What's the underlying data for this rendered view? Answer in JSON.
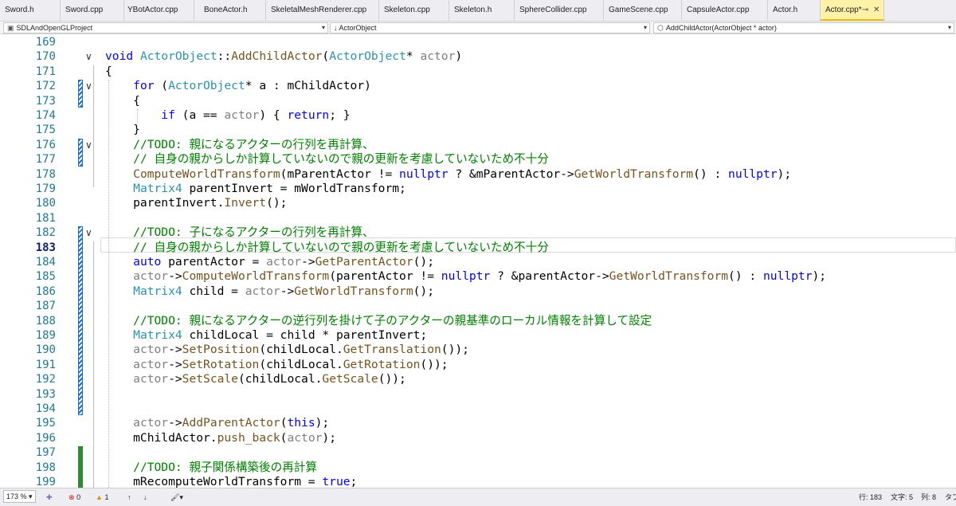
{
  "tabs": [
    {
      "label": "Sword.h",
      "active": false
    },
    {
      "label": "Sword.cpp",
      "active": false
    },
    {
      "label": "YBotActor.cpp",
      "active": false
    },
    {
      "label": "BoneActor.h",
      "active": false
    },
    {
      "label": "SkeletalMeshRenderer.cpp",
      "active": false
    },
    {
      "label": "Skeleton.cpp",
      "active": false
    },
    {
      "label": "Skeleton.h",
      "active": false
    },
    {
      "label": "SphereCollider.cpp",
      "active": false
    },
    {
      "label": "GameScene.cpp",
      "active": false
    },
    {
      "label": "CapsuleActor.cpp",
      "active": false
    },
    {
      "label": "Actor.h",
      "active": false
    },
    {
      "label": "Actor.cpp*",
      "active": true
    }
  ],
  "tab_controls": {
    "pin": "⊸",
    "close": "✕"
  },
  "nav": {
    "project": "SDLAndOpenGLProject",
    "scope": "↓ ActorObject",
    "member": "AddChildActor(ActorObject * actor)"
  },
  "current_line": 183,
  "code_lines": [
    {
      "num": 169,
      "fold": "",
      "tokens": []
    },
    {
      "num": 170,
      "fold": "∨",
      "tokens": [
        {
          "t": "void",
          "c": "kw"
        },
        {
          "t": " "
        },
        {
          "t": "ActorObject",
          "c": "ty"
        },
        {
          "t": "::"
        },
        {
          "t": "AddChildActor",
          "c": "fn"
        },
        {
          "t": "("
        },
        {
          "t": "ActorObject",
          "c": "ty"
        },
        {
          "t": "* "
        },
        {
          "t": "actor",
          "c": "pm"
        },
        {
          "t": ")"
        }
      ]
    },
    {
      "num": 171,
      "fold": "",
      "tokens": [
        {
          "t": "{"
        }
      ]
    },
    {
      "num": 172,
      "fold": "∨",
      "tokens": [
        {
          "t": "    "
        },
        {
          "t": "for",
          "c": "kw"
        },
        {
          "t": " ("
        },
        {
          "t": "ActorObject",
          "c": "ty"
        },
        {
          "t": "* a : mChildActor)"
        }
      ]
    },
    {
      "num": 173,
      "fold": "",
      "tokens": [
        {
          "t": "    {"
        }
      ]
    },
    {
      "num": 174,
      "fold": "",
      "tokens": [
        {
          "t": "        "
        },
        {
          "t": "if",
          "c": "kw"
        },
        {
          "t": " (a == "
        },
        {
          "t": "actor",
          "c": "pm"
        },
        {
          "t": ") { "
        },
        {
          "t": "return",
          "c": "kw"
        },
        {
          "t": "; }"
        }
      ]
    },
    {
      "num": 175,
      "fold": "",
      "tokens": [
        {
          "t": "    }"
        }
      ]
    },
    {
      "num": 176,
      "fold": "∨",
      "tokens": [
        {
          "t": "    "
        },
        {
          "t": "//TODO: 親になるアクターの行列を再計算、",
          "c": "cm"
        }
      ]
    },
    {
      "num": 177,
      "fold": "",
      "tokens": [
        {
          "t": "    "
        },
        {
          "t": "// 自身の親からしか計算していないので親の更新を考慮していないため不十分",
          "c": "cm"
        }
      ]
    },
    {
      "num": 178,
      "fold": "",
      "tokens": [
        {
          "t": "    "
        },
        {
          "t": "ComputeWorldTransform",
          "c": "fn"
        },
        {
          "t": "(mParentActor != "
        },
        {
          "t": "nullptr",
          "c": "kw"
        },
        {
          "t": " ? &mParentActor->"
        },
        {
          "t": "GetWorldTransform",
          "c": "fn"
        },
        {
          "t": "() : "
        },
        {
          "t": "nullptr",
          "c": "kw"
        },
        {
          "t": ");"
        }
      ]
    },
    {
      "num": 179,
      "fold": "",
      "tokens": [
        {
          "t": "    "
        },
        {
          "t": "Matrix4",
          "c": "ty"
        },
        {
          "t": " parentInvert = mWorldTransform;"
        }
      ]
    },
    {
      "num": 180,
      "fold": "",
      "tokens": [
        {
          "t": "    parentInvert."
        },
        {
          "t": "Invert",
          "c": "fn"
        },
        {
          "t": "();"
        }
      ]
    },
    {
      "num": 181,
      "fold": "",
      "tokens": []
    },
    {
      "num": 182,
      "fold": "∨",
      "tokens": [
        {
          "t": "    "
        },
        {
          "t": "//TODO: 子になるアクターの行列を再計算、",
          "c": "cm"
        }
      ]
    },
    {
      "num": 183,
      "fold": "",
      "tokens": [
        {
          "t": "    "
        },
        {
          "t": "// 自身の親からしか計算していないので親の更新を考慮していないため不十分",
          "c": "cm"
        }
      ]
    },
    {
      "num": 184,
      "fold": "",
      "tokens": [
        {
          "t": "    "
        },
        {
          "t": "auto",
          "c": "kw"
        },
        {
          "t": " parentActor = "
        },
        {
          "t": "actor",
          "c": "pm"
        },
        {
          "t": "->"
        },
        {
          "t": "GetParentActor",
          "c": "fn"
        },
        {
          "t": "();"
        }
      ]
    },
    {
      "num": 185,
      "fold": "",
      "tokens": [
        {
          "t": "    "
        },
        {
          "t": "actor",
          "c": "pm"
        },
        {
          "t": "->"
        },
        {
          "t": "ComputeWorldTransform",
          "c": "fn"
        },
        {
          "t": "(parentActor != "
        },
        {
          "t": "nullptr",
          "c": "kw"
        },
        {
          "t": " ? &parentActor->"
        },
        {
          "t": "GetWorldTransform",
          "c": "fn"
        },
        {
          "t": "() : "
        },
        {
          "t": "nullptr",
          "c": "kw"
        },
        {
          "t": ");"
        }
      ]
    },
    {
      "num": 186,
      "fold": "",
      "tokens": [
        {
          "t": "    "
        },
        {
          "t": "Matrix4",
          "c": "ty"
        },
        {
          "t": " child = "
        },
        {
          "t": "actor",
          "c": "pm"
        },
        {
          "t": "->"
        },
        {
          "t": "GetWorldTransform",
          "c": "fn"
        },
        {
          "t": "();"
        }
      ]
    },
    {
      "num": 187,
      "fold": "",
      "tokens": []
    },
    {
      "num": 188,
      "fold": "",
      "tokens": [
        {
          "t": "    "
        },
        {
          "t": "//TODO: 親になるアクターの逆行列を掛けて子のアクターの親基準のローカル情報を計算して設定",
          "c": "cm"
        }
      ]
    },
    {
      "num": 189,
      "fold": "",
      "tokens": [
        {
          "t": "    "
        },
        {
          "t": "Matrix4",
          "c": "ty"
        },
        {
          "t": " childLocal = child * parentInvert;"
        }
      ]
    },
    {
      "num": 190,
      "fold": "",
      "tokens": [
        {
          "t": "    "
        },
        {
          "t": "actor",
          "c": "pm"
        },
        {
          "t": "->"
        },
        {
          "t": "SetPosition",
          "c": "fn"
        },
        {
          "t": "(childLocal."
        },
        {
          "t": "GetTranslation",
          "c": "fn"
        },
        {
          "t": "());"
        }
      ]
    },
    {
      "num": 191,
      "fold": "",
      "tokens": [
        {
          "t": "    "
        },
        {
          "t": "actor",
          "c": "pm"
        },
        {
          "t": "->"
        },
        {
          "t": "SetRotation",
          "c": "fn"
        },
        {
          "t": "(childLocal."
        },
        {
          "t": "GetRotation",
          "c": "fn"
        },
        {
          "t": "());"
        }
      ]
    },
    {
      "num": 192,
      "fold": "",
      "tokens": [
        {
          "t": "    "
        },
        {
          "t": "actor",
          "c": "pm"
        },
        {
          "t": "->"
        },
        {
          "t": "SetScale",
          "c": "fn"
        },
        {
          "t": "(childLocal."
        },
        {
          "t": "GetScale",
          "c": "fn"
        },
        {
          "t": "());"
        }
      ]
    },
    {
      "num": 193,
      "fold": "",
      "tokens": []
    },
    {
      "num": 194,
      "fold": "",
      "tokens": []
    },
    {
      "num": 195,
      "fold": "",
      "tokens": [
        {
          "t": "    "
        },
        {
          "t": "actor",
          "c": "pm"
        },
        {
          "t": "->"
        },
        {
          "t": "AddParentActor",
          "c": "fn"
        },
        {
          "t": "("
        },
        {
          "t": "this",
          "c": "kw"
        },
        {
          "t": ");"
        }
      ]
    },
    {
      "num": 196,
      "fold": "",
      "tokens": [
        {
          "t": "    mChildActor."
        },
        {
          "t": "push_back",
          "c": "fn"
        },
        {
          "t": "("
        },
        {
          "t": "actor",
          "c": "pm"
        },
        {
          "t": ");"
        }
      ]
    },
    {
      "num": 197,
      "fold": "",
      "tokens": []
    },
    {
      "num": 198,
      "fold": "",
      "tokens": [
        {
          "t": "    "
        },
        {
          "t": "//TODO: 親子関係構築後の再計算",
          "c": "cm"
        }
      ]
    },
    {
      "num": 199,
      "fold": "",
      "tokens": [
        {
          "t": "    mRecomputeWorldTransform = "
        },
        {
          "t": "true",
          "c": "kw"
        },
        {
          "t": ";"
        }
      ]
    }
  ],
  "change_markers": [
    {
      "from": 172,
      "to": 173,
      "style": "hatch"
    },
    {
      "from": 176,
      "to": 177,
      "style": "hatch"
    },
    {
      "from": 182,
      "to": 194,
      "style": "hatch"
    },
    {
      "from": 197,
      "to": 199,
      "style": "green"
    }
  ],
  "status": {
    "zoom": "173 %",
    "errors": "0",
    "warnings": "1",
    "line": "行: 183",
    "char": "文字: 5",
    "col": "列: 8",
    "tab": "タブ"
  },
  "colors": {
    "comment": "#008000",
    "keyword": "#0000ff",
    "type": "#2b91af",
    "function": "#74531f",
    "parameter": "#808080",
    "line_number": "#237893",
    "change_saved": "#2e8b2e",
    "change_unsaved": "#1a6fd0",
    "active_tab": "#fff1a8"
  }
}
